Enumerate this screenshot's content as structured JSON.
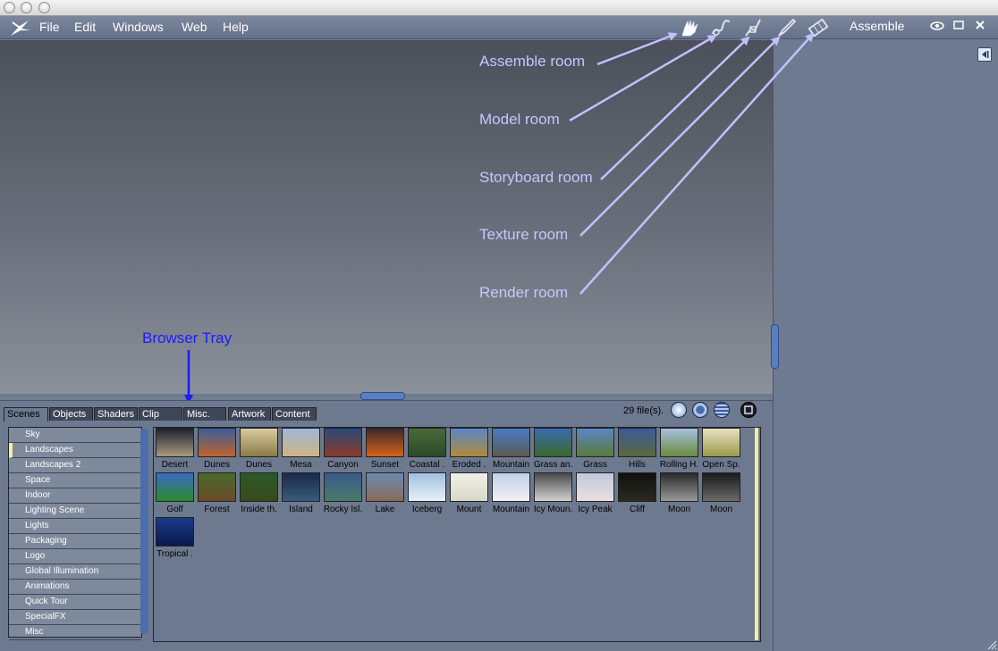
{
  "menubar": {
    "items": [
      "File",
      "Edit",
      "Windows",
      "Web",
      "Help"
    ],
    "room_name": "Assemble"
  },
  "annotations": {
    "assemble": "Assemble room",
    "model": "Model room",
    "storyboard": "Storyboard room",
    "texture": "Texture room",
    "render": "Render room",
    "browser_tray": "Browser Tray"
  },
  "tray": {
    "tabs": [
      "Scenes",
      "Objects",
      "Shaders",
      "Clip",
      "Misc.",
      "Artwork",
      "Content"
    ],
    "active_tab": "Scenes",
    "file_count": "29 file(s).",
    "categories": [
      "Sky",
      "Landscapes",
      "Landscapes 2",
      "Space",
      "Indoor",
      "Lighting Scene",
      "Lights",
      "Packaging",
      "Logo",
      "Global Illumination",
      "Animations",
      "Quick Tour",
      "SpecialFX",
      "Misc"
    ],
    "selected_category": "Landscapes",
    "thumbnails": [
      {
        "label": "Desert",
        "top": "#1c2233",
        "bottom": "#a89a7a"
      },
      {
        "label": "Dunes",
        "top": "#3b5e9a",
        "bottom": "#c0622a"
      },
      {
        "label": "Dunes",
        "top": "#d9cba0",
        "bottom": "#8a7a44"
      },
      {
        "label": "Mesa",
        "top": "#9fb6d6",
        "bottom": "#cdb582"
      },
      {
        "label": "Canyon",
        "top": "#2a4a7a",
        "bottom": "#8a3a2a"
      },
      {
        "label": "Sunset",
        "top": "#3a2a2a",
        "bottom": "#d8621a"
      },
      {
        "label": "Coastal .",
        "top": "#4a6a3a",
        "bottom": "#2a4a2a"
      },
      {
        "label": "Eroded .",
        "top": "#5a86c6",
        "bottom": "#b08a3a"
      },
      {
        "label": "Mountain",
        "top": "#4a7ac6",
        "bottom": "#5a5a50"
      },
      {
        "label": "Grass an.",
        "top": "#3a6ab0",
        "bottom": "#3a6a2a"
      },
      {
        "label": "Grass",
        "top": "#5a86c6",
        "bottom": "#5a7a3a"
      },
      {
        "label": "Hills",
        "top": "#3a5a9a",
        "bottom": "#5a6a3a"
      },
      {
        "label": "Rolling H.",
        "top": "#a6c0e0",
        "bottom": "#6a8a3a"
      },
      {
        "label": "Open Sp.",
        "top": "#e8e0c0",
        "bottom": "#9a9a4a"
      },
      {
        "label": "Golf",
        "top": "#3a6ac6",
        "bottom": "#2a8a2a"
      },
      {
        "label": "Forest",
        "top": "#4a6a2a",
        "bottom": "#6a4a2a"
      },
      {
        "label": "Inside th.",
        "top": "#2a5a2a",
        "bottom": "#3a4a1a"
      },
      {
        "label": "Island",
        "top": "#1a2a4a",
        "bottom": "#3a5a7a"
      },
      {
        "label": "Rocky Isl.",
        "top": "#3a5a8a",
        "bottom": "#4a7a6a"
      },
      {
        "label": "Lake",
        "top": "#6a8ab0",
        "bottom": "#8a6a5a"
      },
      {
        "label": "Iceberg",
        "top": "#a0c0e0",
        "bottom": "#e8f0f8"
      },
      {
        "label": "Mount",
        "top": "#f0f0e8",
        "bottom": "#d8d8c8"
      },
      {
        "label": "Mountain",
        "top": "#c0d0e8",
        "bottom": "#f0f0f0"
      },
      {
        "label": "Icy Moun.",
        "top": "#4a4a4a",
        "bottom": "#d0d0d0"
      },
      {
        "label": "Icy Peak",
        "top": "#c0c8d8",
        "bottom": "#e8e0e0"
      },
      {
        "label": "Cliff",
        "top": "#101010",
        "bottom": "#2a2a20"
      },
      {
        "label": "Moon",
        "top": "#2a2a2a",
        "bottom": "#9a9a9a"
      },
      {
        "label": "Moon",
        "top": "#1a1a1a",
        "bottom": "#6a6a6a"
      },
      {
        "label": "Tropical .",
        "top": "#1a3a8a",
        "bottom": "#0a1a4a"
      }
    ]
  },
  "colors": {
    "annotation_arrow": "#c2c0ff",
    "browser_tray_label": "#1b1bff",
    "workspace_top": "#4b505a",
    "panel": "#6e7a90"
  }
}
